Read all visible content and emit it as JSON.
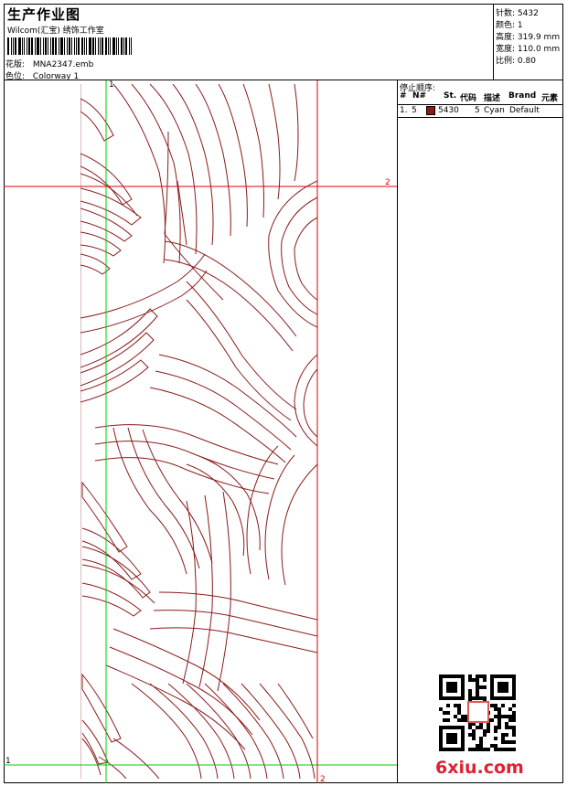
{
  "header": {
    "title": "生产作业图",
    "studio": "Wilcom(汇宝) 绣饰工作室",
    "design_label": "花版:",
    "design_file": "MNA2347.emb",
    "colorway_label": "色位:",
    "colorway": "Colorway 1"
  },
  "stats": [
    {
      "label": "针数:",
      "value": "5432"
    },
    {
      "label": "颜色:",
      "value": "1"
    },
    {
      "label": "高度:",
      "value": "319.9 mm"
    },
    {
      "label": "宽度:",
      "value": "110.0 mm"
    },
    {
      "label": "比例:",
      "value": "0.80"
    }
  ],
  "stop_sequence": {
    "title": "停止顺序:",
    "columns": [
      "#",
      "N#",
      "St.",
      "代码",
      "描述",
      "Brand",
      "元素"
    ],
    "rows": [
      {
        "index": "1.",
        "needle": "5",
        "swatch_color": "#8b1a1a",
        "stitches": "5430",
        "code": "5",
        "description": "Cyan",
        "brand": "Default"
      }
    ]
  },
  "guides": {
    "green_label": "1",
    "red_label": "2"
  },
  "colors": {
    "thread": "#8b1a1a",
    "guide_green": "#00cc00",
    "guide_red": "#dd0000"
  },
  "watermark": "6xiu.com"
}
